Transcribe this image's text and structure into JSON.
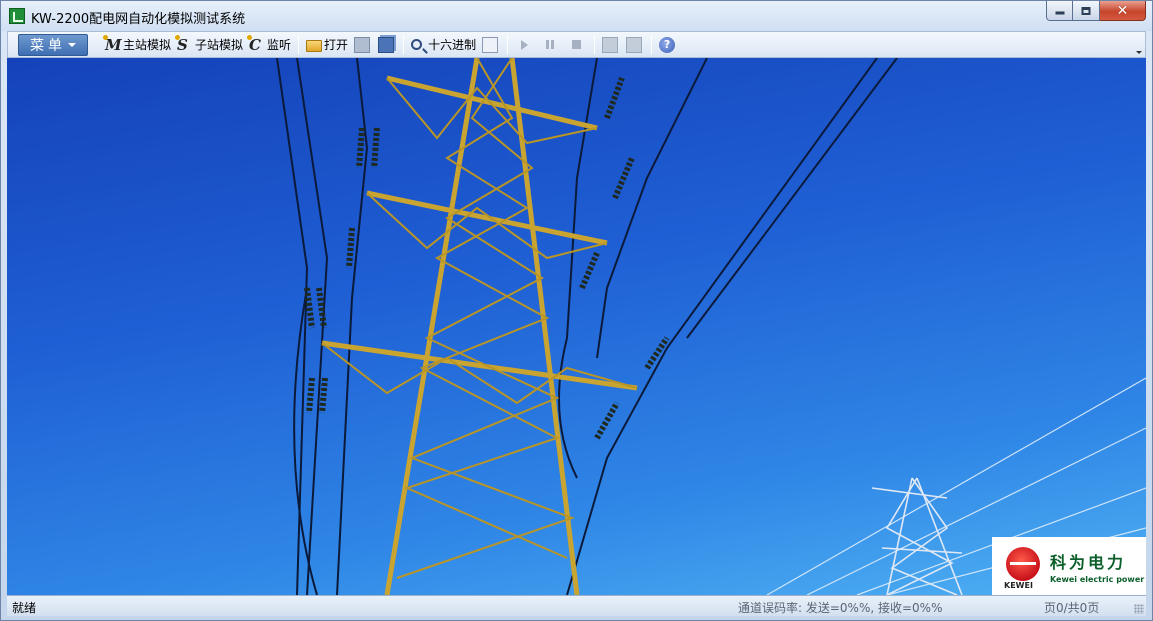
{
  "window": {
    "title": "KW-2200配电网自动化模拟测试系统",
    "controls": {
      "minimize": "minimize-icon",
      "maximize": "restore-icon",
      "close_glyph": "✕"
    }
  },
  "toolbar": {
    "menu_label": "菜单",
    "master_sim": "主站模拟",
    "slave_sim": "子站模拟",
    "monitor": "监听",
    "open": "打开",
    "hex": "十六进制",
    "help_glyph": "?"
  },
  "logo": {
    "mark_text": "KEWEI",
    "cn": "科为电力",
    "en": "Kewei electric power"
  },
  "statusbar": {
    "ready": "就绪",
    "channel": "通道误码率: 发送=0%%, 接收=0%%",
    "page": "页0/共0页"
  }
}
